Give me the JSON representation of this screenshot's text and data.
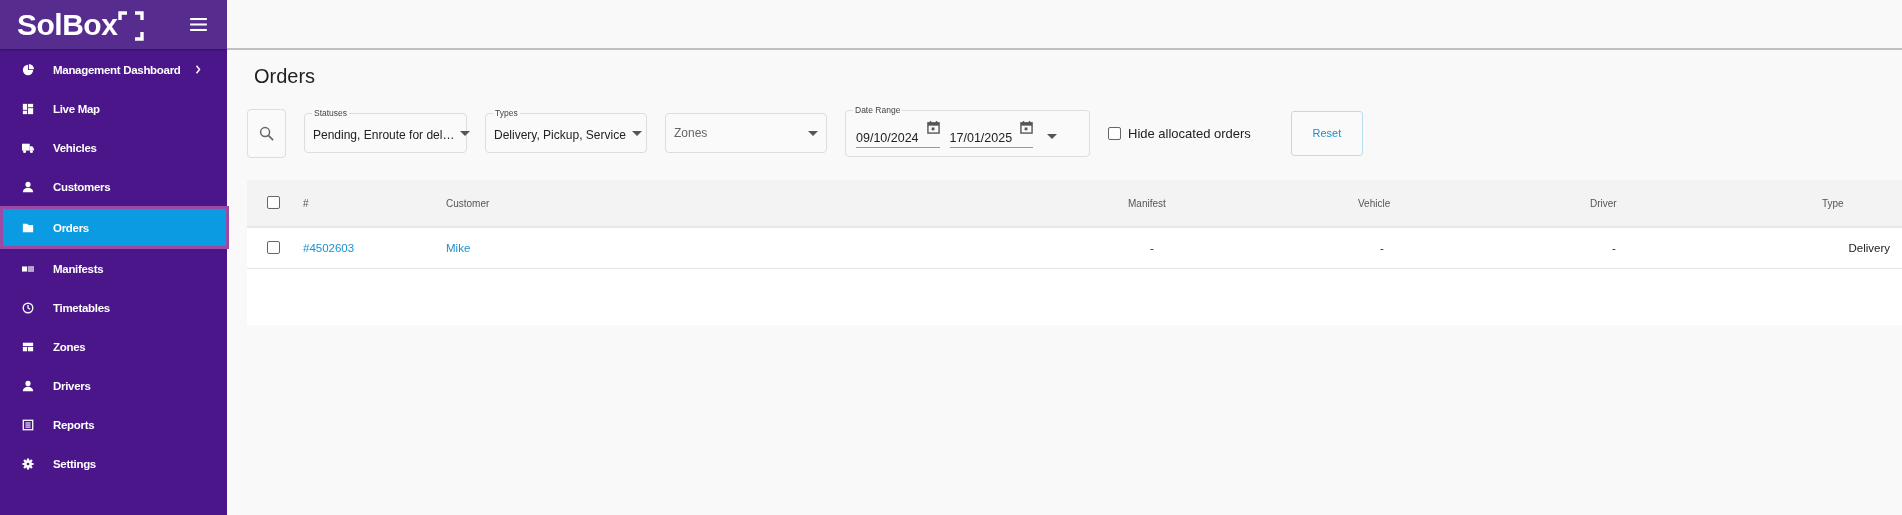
{
  "logo": {
    "text": "SolBox"
  },
  "sidebar": {
    "items": [
      {
        "label": "Management Dashboard",
        "kind": "group",
        "selected": false
      },
      {
        "label": "Live Map",
        "kind": "link",
        "selected": false
      },
      {
        "label": "Vehicles",
        "kind": "link",
        "selected": false
      },
      {
        "label": "Customers",
        "kind": "link",
        "selected": false
      },
      {
        "label": "Orders",
        "kind": "link",
        "selected": true
      },
      {
        "label": "Manifests",
        "kind": "link",
        "selected": false
      },
      {
        "label": "Timetables",
        "kind": "link",
        "selected": false
      },
      {
        "label": "Zones",
        "kind": "link",
        "selected": false
      },
      {
        "label": "Drivers",
        "kind": "link",
        "selected": false
      },
      {
        "label": "Reports",
        "kind": "link",
        "selected": false
      },
      {
        "label": "Settings",
        "kind": "link",
        "selected": false
      }
    ]
  },
  "page": {
    "title": "Orders"
  },
  "filters": {
    "statuses": {
      "label": "Statuses",
      "value": "Pending, Enroute for del…"
    },
    "types": {
      "label": "Types",
      "value": "Delivery, Pickup, Service"
    },
    "zones": {
      "placeholder": "Zones"
    },
    "date_range": {
      "label": "Date Range",
      "start": "09/10/2024",
      "end": "17/01/2025"
    },
    "hide_allocated": {
      "label": "Hide allocated orders",
      "checked": false
    },
    "reset_button": "Reset"
  },
  "table": {
    "select_all_checked": false,
    "columns": [
      "#",
      "Customer",
      "Manifest",
      "Vehicle",
      "Driver",
      "Type"
    ],
    "rows": [
      {
        "checked": false,
        "cells": [
          "#4502603",
          "Mike",
          "-",
          "-",
          "-",
          "Delivery"
        ]
      }
    ]
  }
}
